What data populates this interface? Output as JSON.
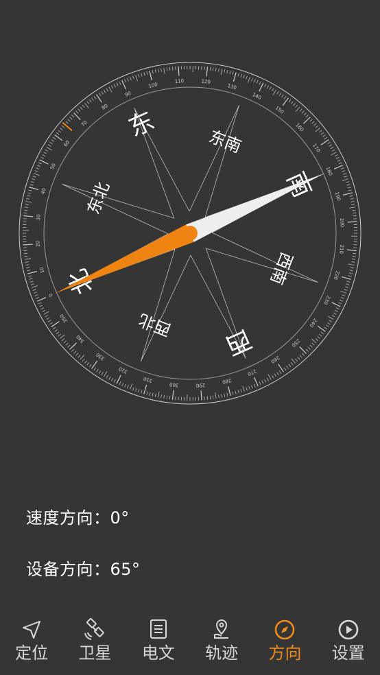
{
  "compass": {
    "directions": [
      "北",
      "东北",
      "东",
      "东南",
      "南",
      "西南",
      "西",
      "西北"
    ],
    "degree_labels": [
      "0",
      "10",
      "20",
      "30",
      "40",
      "50",
      "60",
      "70",
      "80",
      "90",
      "100",
      "110",
      "120",
      "130",
      "140",
      "150",
      "160",
      "170",
      "180",
      "190",
      "200",
      "210",
      "220",
      "230",
      "240",
      "250",
      "260",
      "270",
      "280",
      "290",
      "300",
      "310",
      "320",
      "330",
      "340",
      "350"
    ],
    "heading_deg": 65,
    "colors": {
      "north_needle": "#ef8412",
      "south_needle": "#eeeeee",
      "marker": "#ef8412",
      "ring": "#cfcfcf"
    }
  },
  "readouts": {
    "speed_label": "速度方向：",
    "speed_value": "0°",
    "device_label": "设备方向：",
    "device_value": "65°"
  },
  "nav": {
    "items": [
      {
        "label": "定位",
        "icon": "location-arrow-icon"
      },
      {
        "label": "卫星",
        "icon": "satellite-icon"
      },
      {
        "label": "电文",
        "icon": "document-icon"
      },
      {
        "label": "轨迹",
        "icon": "map-pin-icon"
      },
      {
        "label": "方向",
        "icon": "compass-icon"
      },
      {
        "label": "设置",
        "icon": "play-circle-icon"
      }
    ],
    "active_index": 4,
    "active_color": "#f08c1e"
  }
}
